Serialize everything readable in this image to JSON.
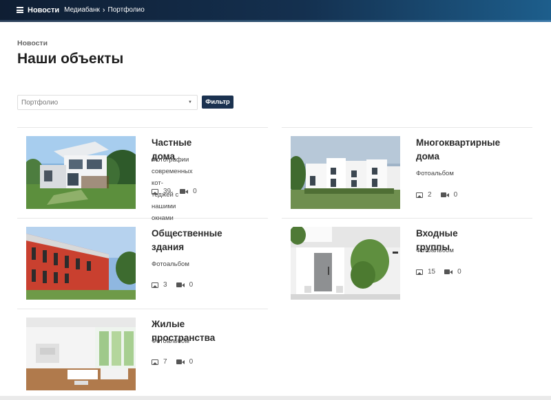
{
  "topbar": {
    "brand": "Новости",
    "breadcrumb": [
      "Медиабанк",
      "Портфолио"
    ]
  },
  "header": {
    "section_label": "Новости",
    "title": "Наши объекты"
  },
  "filter": {
    "select_value": "Портфолио",
    "button_label": "Фильтр"
  },
  "cards": [
    {
      "title_lines": [
        "Частные дома"
      ],
      "desc_lines": [
        "Фотографии современных кот-",
        "теджей с нашими окнами"
      ],
      "photos": "39",
      "videos": "0"
    },
    {
      "title_lines": [
        "Многоквартирные",
        "дома"
      ],
      "desc_lines": [
        "Фотоальбом"
      ],
      "photos": "2",
      "videos": "0"
    },
    {
      "title_lines": [
        "Общественные",
        "здания"
      ],
      "desc_lines": [
        "Фотоальбом"
      ],
      "photos": "3",
      "videos": "0"
    },
    {
      "title_lines": [
        "Входные группы"
      ],
      "desc_lines": [
        "Фотоальбом"
      ],
      "photos": "15",
      "videos": "0"
    },
    {
      "title_lines": [
        "Жилые пространства"
      ],
      "desc_lines": [
        "Фотоальбом"
      ],
      "photos": "7",
      "videos": "0"
    }
  ],
  "colors": {
    "topbar_dark": "#0f1e33",
    "topbar_light": "#1d5e8c",
    "button": "#1b3250"
  },
  "icons": {
    "menu": "hamburger-icon",
    "photo": "image-icon",
    "video": "video-camera-icon"
  }
}
